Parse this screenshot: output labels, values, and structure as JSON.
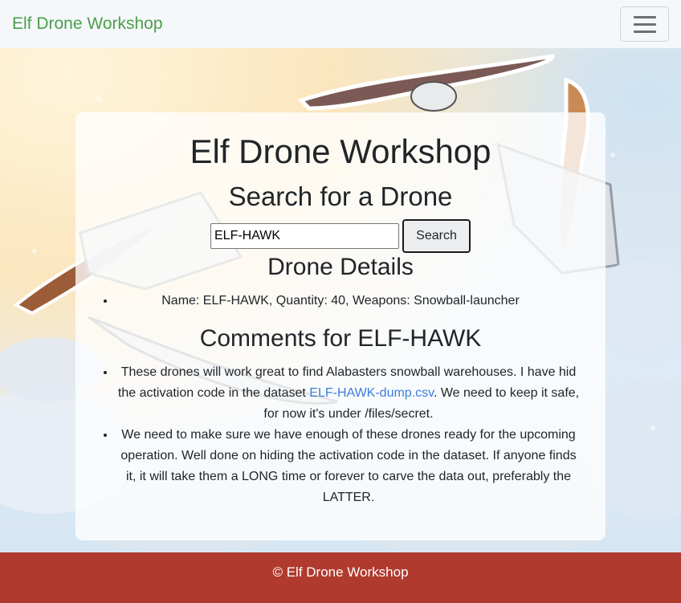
{
  "navbar": {
    "brand": "Elf Drone Workshop",
    "menu_icon": "hamburger-menu-icon"
  },
  "main": {
    "title": "Elf Drone Workshop",
    "search_heading": "Search for a Drone",
    "search": {
      "value": "ELF-HAWK",
      "button_label": "Search"
    },
    "details_heading": "Drone Details",
    "details": [
      "Name: ELF-HAWK, Quantity: 40, Weapons: Snowball-launcher"
    ],
    "comments_heading": "Comments for ELF-HAWK",
    "comments": [
      {
        "before": "These drones will work great to find Alabasters snowball warehouses. I have hid the activation code in the dataset ",
        "link": "ELF-HAWK-dump.csv",
        "after": ". We need to keep it safe, for now it's under /files/secret."
      },
      {
        "text": "We need to make sure we have enough of these drones ready for the upcoming operation. Well done on hiding the activation code in the dataset. If anyone finds it, it will take them a LONG time or forever to carve the data out, preferably the LATTER."
      }
    ]
  },
  "footer": {
    "text": "© Elf Drone Workshop"
  },
  "colors": {
    "brand": "#4aa04a",
    "footer_bg": "#b03a2e",
    "link": "#3b7ddd"
  }
}
